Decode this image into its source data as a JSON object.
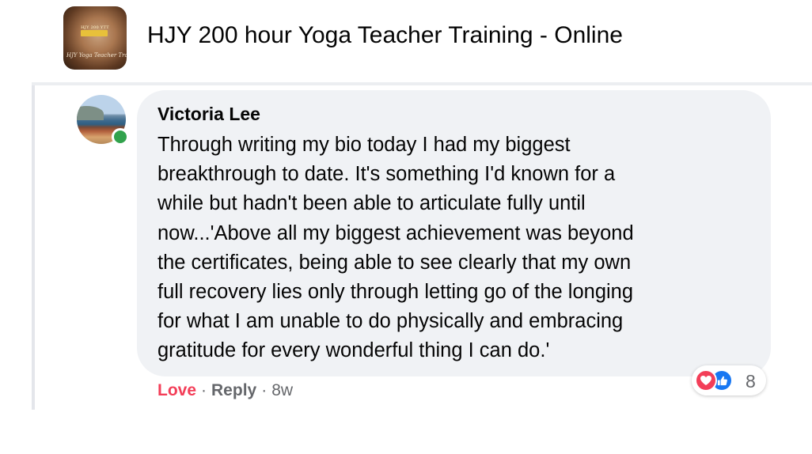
{
  "group": {
    "title": "HJY 200 hour Yoga Teacher Training - Online",
    "avatar_banner": "HJY 200 YTT",
    "avatar_script": "HJY Yoga Teacher Train"
  },
  "comment": {
    "author": "Victoria Lee",
    "online": true,
    "text_lines": [
      "Through writing my bio today I had my biggest",
      "breakthrough to date. It's something I'd known for a",
      "while but hadn't been able to articulate fully until",
      "now...'Above all my biggest achievement was beyond",
      "the certificates, being able to see clearly that my own",
      "full recovery lies only through letting go of the longing",
      "for what I am unable to do physically and embracing",
      "gratitude for every wonderful thing I can do.'"
    ],
    "reactions": {
      "icons": [
        "love-icon",
        "like-icon"
      ],
      "count": "8"
    },
    "actions": {
      "love_label": "Love",
      "separator": "·",
      "reply_label": "Reply",
      "timestamp": "8w"
    }
  },
  "colors": {
    "bubble": "#f0f2f5",
    "love": "#f33e58",
    "like": "#1877f2",
    "online": "#31a24c",
    "secondary_text": "#65676b"
  }
}
